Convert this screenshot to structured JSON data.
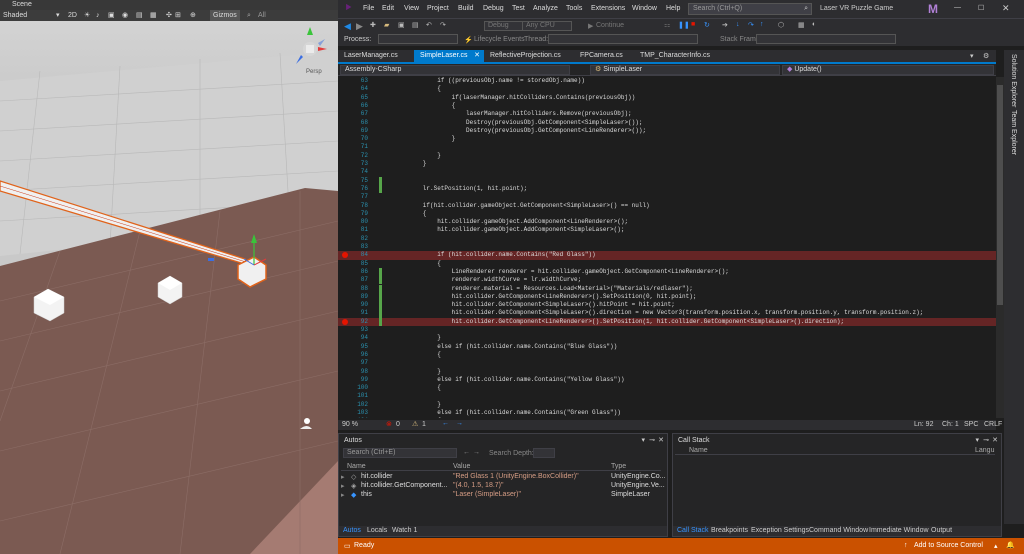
{
  "unity": {
    "tab": "Scene",
    "shading": "Shaded",
    "mode2d": "2D",
    "gizmos": "Gizmos",
    "search": "All",
    "view_label": "Persp"
  },
  "vs": {
    "menu": [
      "File",
      "Edit",
      "View",
      "Project",
      "Build",
      "Debug",
      "Test",
      "Analyze",
      "Tools",
      "Extensions",
      "Window",
      "Help"
    ],
    "search_placeholder": "Search (Ctrl+Q)",
    "app_title": "Laser VR Puzzle Game",
    "logo": "M",
    "toolbar": {
      "config": "Debug",
      "platform": "Any CPU",
      "continue": "Continue"
    },
    "procbar": {
      "process_label": "Process:",
      "lifecycle": "Lifecycle Events",
      "thread": "Thread:",
      "stackframe": "Stack Frame:"
    },
    "tabs": [
      "LaserManager.cs",
      "SimpleLaser.cs",
      "ReflectiveProjection.cs",
      "FPCamera.cs",
      "TMP_CharacterInfo.cs"
    ],
    "active_tab": "SimpleLaser.cs",
    "nav": {
      "project": "Assembly-CSharp",
      "class": "SimpleLaser",
      "member": "Update()"
    },
    "code": [
      {
        "n": "63",
        "t": "            if ((previousObj.name != storedObj.name))"
      },
      {
        "n": "64",
        "t": "            {"
      },
      {
        "n": "65",
        "t": "                if(laserManager.hitColliders.Contains(previousObj))"
      },
      {
        "n": "66",
        "t": "                {"
      },
      {
        "n": "67",
        "t": "                    laserManager.hitColliders.Remove(previousObj);"
      },
      {
        "n": "68",
        "t": "                    Destroy(previousObj.GetComponent<SimpleLaser>());"
      },
      {
        "n": "69",
        "t": "                    Destroy(previousObj.GetComponent<LineRenderer>());"
      },
      {
        "n": "70",
        "t": "                }"
      },
      {
        "n": "71",
        "t": ""
      },
      {
        "n": "72",
        "t": "            }"
      },
      {
        "n": "73",
        "t": "        }"
      },
      {
        "n": "74",
        "t": ""
      },
      {
        "n": "75",
        "t": ""
      },
      {
        "n": "76",
        "t": "        lr.SetPosition(1, hit.point);"
      },
      {
        "n": "77",
        "t": ""
      },
      {
        "n": "78",
        "t": "        if(hit.collider.gameObject.GetComponent<SimpleLaser>() == null)"
      },
      {
        "n": "79",
        "t": "        {"
      },
      {
        "n": "80",
        "t": "            hit.collider.gameObject.AddComponent<LineRenderer>();"
      },
      {
        "n": "81",
        "t": "            hit.collider.gameObject.AddComponent<SimpleLaser>();"
      },
      {
        "n": "82",
        "t": ""
      },
      {
        "n": "83",
        "t": ""
      },
      {
        "n": "84",
        "t": "            if (hit.collider.name.Contains(\"Red Glass\"))",
        "bp": true
      },
      {
        "n": "85",
        "t": "            {"
      },
      {
        "n": "86",
        "t": "                LineRenderer renderer = hit.collider.gameObject.GetComponent<LineRenderer>();"
      },
      {
        "n": "87",
        "t": "                renderer.widthCurve = lr.widthCurve;"
      },
      {
        "n": "88",
        "t": "                renderer.material = Resources.Load<Material>(\"Materials/redlaser\");"
      },
      {
        "n": "89",
        "t": "                hit.collider.GetComponent<LineRenderer>().SetPosition(0, hit.point);"
      },
      {
        "n": "90",
        "t": "                hit.collider.GetComponent<SimpleLaser>().hitPoint = hit.point;"
      },
      {
        "n": "91",
        "t": "                hit.collider.GetComponent<SimpleLaser>().direction = new Vector3(transform.position.x, transform.position.y, transform.position.z);"
      },
      {
        "n": "92",
        "t": "                hit.collider.GetComponent<LineRenderer>().SetPosition(1, hit.collider.GetComponent<SimpleLaser>().direction);",
        "bp": true
      },
      {
        "n": "93",
        "t": ""
      },
      {
        "n": "94",
        "t": "            }"
      },
      {
        "n": "95",
        "t": "            else if (hit.collider.name.Contains(\"Blue Glass\"))"
      },
      {
        "n": "96",
        "t": "            {"
      },
      {
        "n": "97",
        "t": ""
      },
      {
        "n": "98",
        "t": "            }"
      },
      {
        "n": "99",
        "t": "            else if (hit.collider.name.Contains(\"Yellow Glass\"))"
      },
      {
        "n": "100",
        "t": "            {"
      },
      {
        "n": "101",
        "t": ""
      },
      {
        "n": "102",
        "t": "            }"
      },
      {
        "n": "103",
        "t": "            else if (hit.collider.name.Contains(\"Green Glass\"))"
      },
      {
        "n": "104",
        "t": "            {"
      },
      {
        "n": "105",
        "t": ""
      }
    ],
    "editor_status": {
      "zoom": "90 %",
      "errors": "0",
      "warnings": "1",
      "line": "Ln: 92",
      "col": "Ch: 1",
      "spc": "SPC",
      "crlf": "CRLF"
    },
    "side_tabs": [
      "Solution Explorer",
      "Team Explorer"
    ],
    "autos": {
      "title": "Autos",
      "search_placeholder": "Search (Ctrl+E)",
      "search_depth": "Search Depth:",
      "headers": [
        "Name",
        "Value",
        "Type"
      ],
      "rows": [
        {
          "name": "hit.collider",
          "value": "\"Red Glass 1 (UnityEngine.BoxCollider)\"",
          "type": "UnityEngine.Co..."
        },
        {
          "name": "hit.collider.GetComponent...",
          "value": "\"(4.0, 1.5, 18.7)\"",
          "type": "UnityEngine.Ve..."
        },
        {
          "name": "this",
          "value": "\"Laser (SimpleLaser)\"",
          "type": "SimpleLaser"
        }
      ],
      "tabs": [
        "Autos",
        "Locals",
        "Watch 1"
      ]
    },
    "callstack": {
      "title": "Call Stack",
      "headers": [
        "Name",
        "Langu"
      ],
      "tabs": [
        "Call Stack",
        "Breakpoints",
        "Exception Settings",
        "Command Window",
        "Immediate Window",
        "Output"
      ]
    },
    "status": {
      "ready": "Ready",
      "source_control": "Add to Source Control"
    },
    "colors": {
      "accent": "#007acc",
      "status_bar": "#ca5100",
      "breakpoint": "#e51400"
    }
  }
}
